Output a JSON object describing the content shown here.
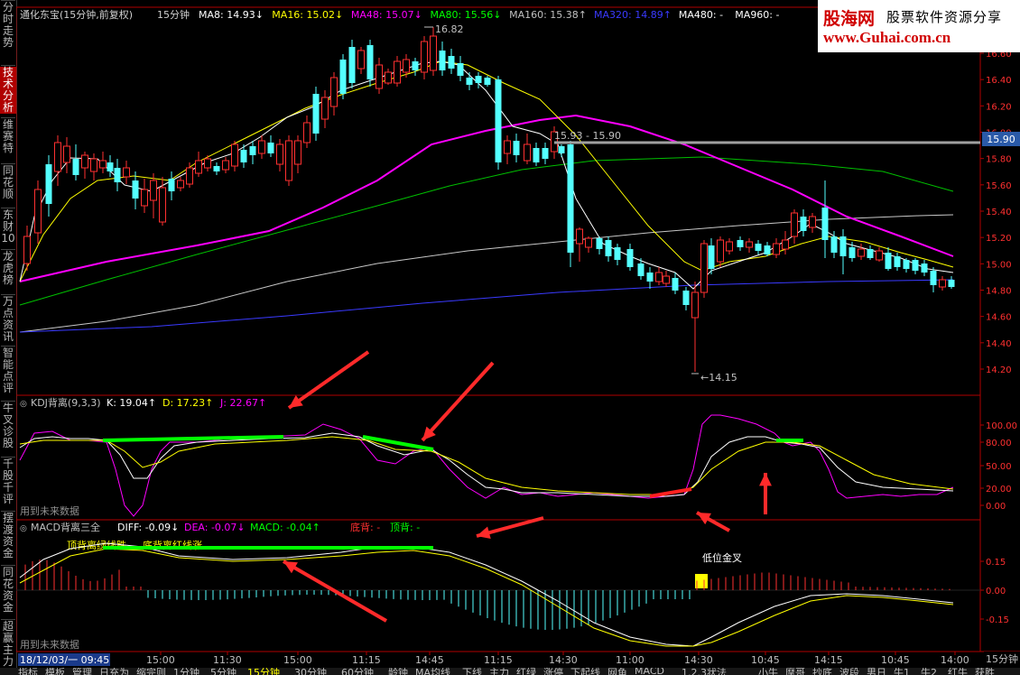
{
  "sidebar": {
    "items": [
      {
        "label": "分时走势",
        "active": false
      },
      {
        "label": "技术分析",
        "active": true
      },
      {
        "label": "维赛特",
        "active": false
      },
      {
        "label": "同花顺",
        "active": false
      },
      {
        "label": "东财10",
        "active": false
      },
      {
        "label": "龙虎榜",
        "active": false
      },
      {
        "label": "万点资讯",
        "active": false
      },
      {
        "label": "智能点评",
        "active": false
      },
      {
        "label": "牛叉诊股",
        "active": false
      },
      {
        "label": "千股千评",
        "active": false
      },
      {
        "label": "摆渡资金",
        "active": false
      },
      {
        "label": "同花资金",
        "active": false
      },
      {
        "label": "超赢主力",
        "active": false
      }
    ]
  },
  "brand": {
    "logo": "股海网",
    "slogan": "股票软件资源分享",
    "url": "www.Guhai.com.cn"
  },
  "main_panel": {
    "title": "通化东宝(15分钟,前复权)",
    "period": "15分钟",
    "ma": [
      {
        "label": "MA8: 14.93↓",
        "color": "#ffffff"
      },
      {
        "label": "MA16: 15.02↓",
        "color": "#ffff00"
      },
      {
        "label": "MA48: 15.07↓",
        "color": "#ff00ff"
      },
      {
        "label": "MA80: 15.56↓",
        "color": "#00ff00"
      },
      {
        "label": "MA160: 15.38↑",
        "color": "#c0c0c0"
      },
      {
        "label": "MA320: 14.89↑",
        "color": "#3a3aff"
      },
      {
        "label": "MA480: -",
        "color": "#ffffff"
      },
      {
        "label": "MA960: -",
        "color": "#ffffff"
      }
    ],
    "price_ticks": [
      "16.60",
      "16.40",
      "16.20",
      "16.00",
      "15.80",
      "15.60",
      "15.40",
      "15.20",
      "15.00",
      "14.80",
      "14.60",
      "14.40",
      "14.20"
    ],
    "high_label": "16.82",
    "low_label": "14.15",
    "range_label": "15.93 - 15.90",
    "current_price_tag": "15.90"
  },
  "kdj_panel": {
    "title": "KDJ背离(9,3,3)",
    "k": "K: 19.04↑",
    "d": "D: 17.23↑",
    "j": "J: 22.67↑",
    "ticks": [
      "100.00",
      "80.00",
      "50.00",
      "20.00",
      "0.00"
    ],
    "note": "用到未来数据"
  },
  "macd_panel": {
    "title": "MACD背离三全",
    "diff": "DIFF: -0.09↓",
    "dea": "DEA: -0.07↓",
    "macd": "MACD: -0.04↑",
    "bottom_div": "底背: -",
    "top_div": "顶背: -",
    "annot_top": "顶背离绿线跌",
    "annot_bottom": "底背离红线涨",
    "golden_cross": "低位金叉",
    "ticks": [
      "0.15",
      "0.00",
      "-0.15"
    ],
    "note": "用到未来数据"
  },
  "time_axis": {
    "start": "18/12/03/一 09:45",
    "labels": [
      "15:00",
      "11:30",
      "15:00",
      "11:15",
      "14:45",
      "11:15",
      "14:30",
      "11:00",
      "14:30",
      "10:45",
      "14:15",
      "10:45",
      "14:00"
    ]
  },
  "bottom_tabs": [
    "指标",
    "模板",
    "管理",
    "日充为",
    "缩完则",
    "1分钟",
    "5分钟",
    "15分钟",
    "30分钟",
    "60分钟",
    "龄钟",
    "MA均线",
    "下线",
    "主力",
    "红绿",
    "涨停",
    "下起线",
    "网鱼",
    "MACD",
    "1.2.3状法",
    "小牛",
    "摩哥",
    "抄底",
    "波段",
    "男日",
    "牛1",
    "牛2",
    "红牛",
    "获胜"
  ],
  "active_tab": "15分钟",
  "period_label": "15分钟"
}
